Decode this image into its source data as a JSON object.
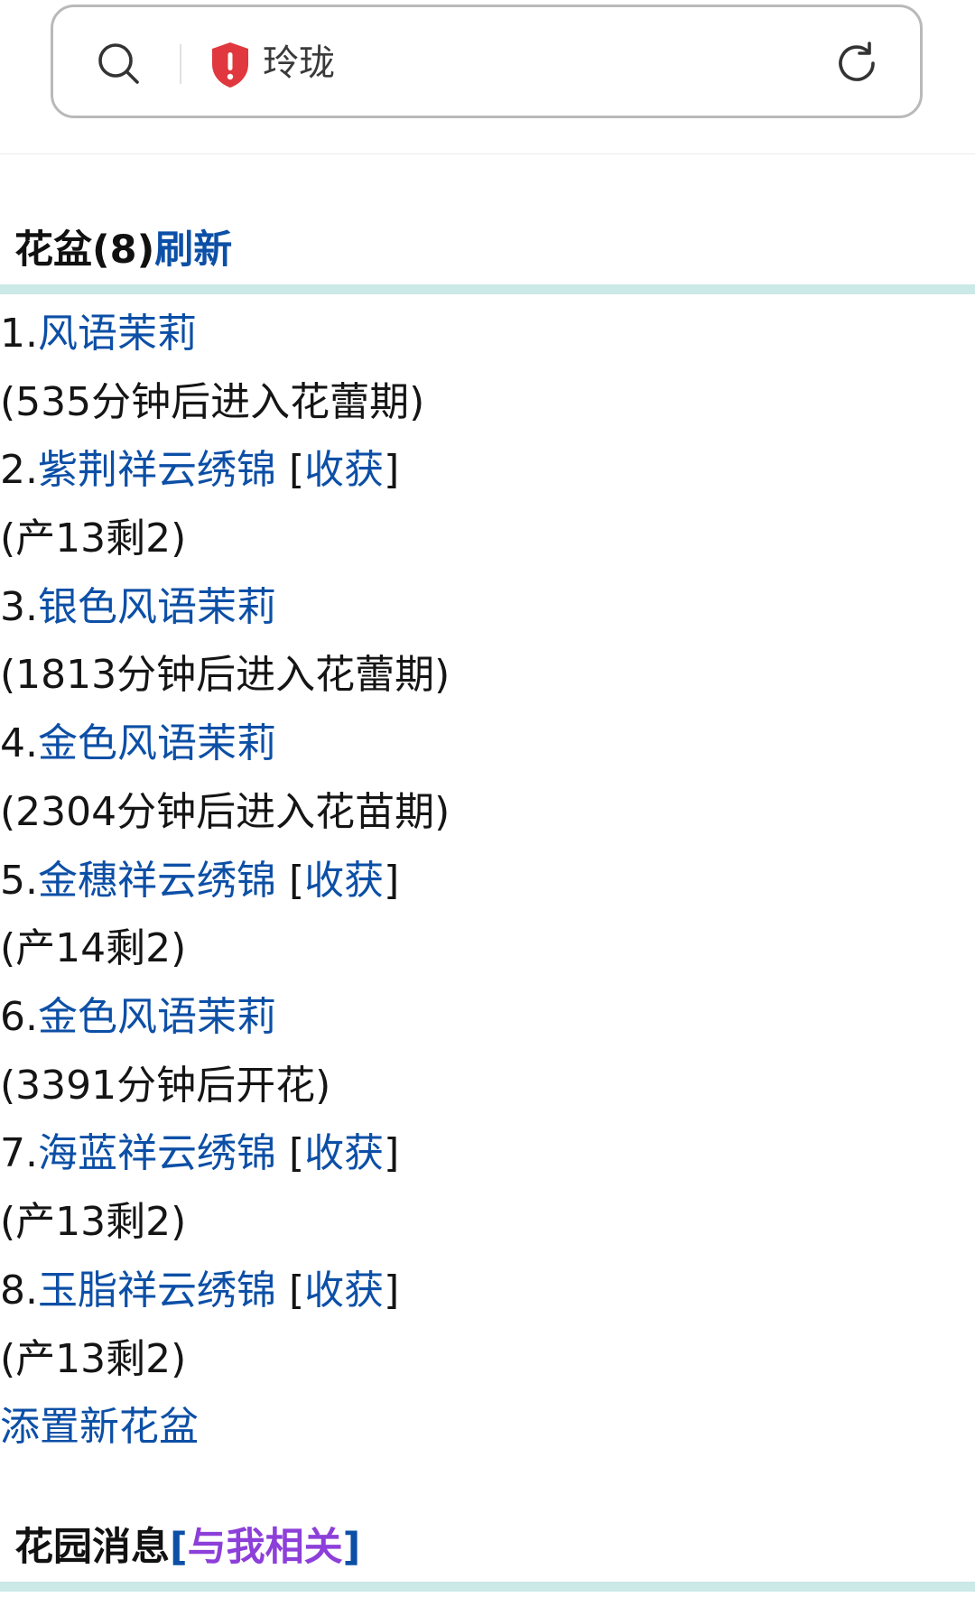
{
  "browser": {
    "url_text": "玲珑"
  },
  "pots": {
    "title_text": "花盆(8)",
    "refresh_label": "刷新",
    "items": [
      {
        "num": "1.",
        "name": "风语茉莉",
        "status": "(535分钟后进入花蕾期)"
      },
      {
        "num": "2.",
        "name": "紫荆祥云绣锦",
        "action": "收获",
        "status": "(产13剩2)"
      },
      {
        "num": "3.",
        "name": "银色风语茉莉",
        "status": "(1813分钟后进入花蕾期)"
      },
      {
        "num": "4.",
        "name": "金色风语茉莉",
        "status": "(2304分钟后进入花苗期)"
      },
      {
        "num": "5.",
        "name": "金穗祥云绣锦",
        "action": "收获",
        "status": "(产14剩2)"
      },
      {
        "num": "6.",
        "name": "金色风语茉莉",
        "status": "(3391分钟后开花)"
      },
      {
        "num": "7.",
        "name": "海蓝祥云绣锦",
        "action": "收获",
        "status": "(产13剩2)"
      },
      {
        "num": "8.",
        "name": "玉脂祥云绣锦",
        "action": "收获",
        "status": "(产13剩2)"
      }
    ],
    "add_label": "添置新花盆"
  },
  "garden_news": {
    "title_text": "花园消息",
    "bracket_open": "[",
    "link_label": "与我相关",
    "bracket_close": "]"
  },
  "colors": {
    "link": "#0c4fa6",
    "link_purple": "#8d3fd9",
    "divider": "#cbe9e6",
    "warning_shield": "#e0383e"
  }
}
